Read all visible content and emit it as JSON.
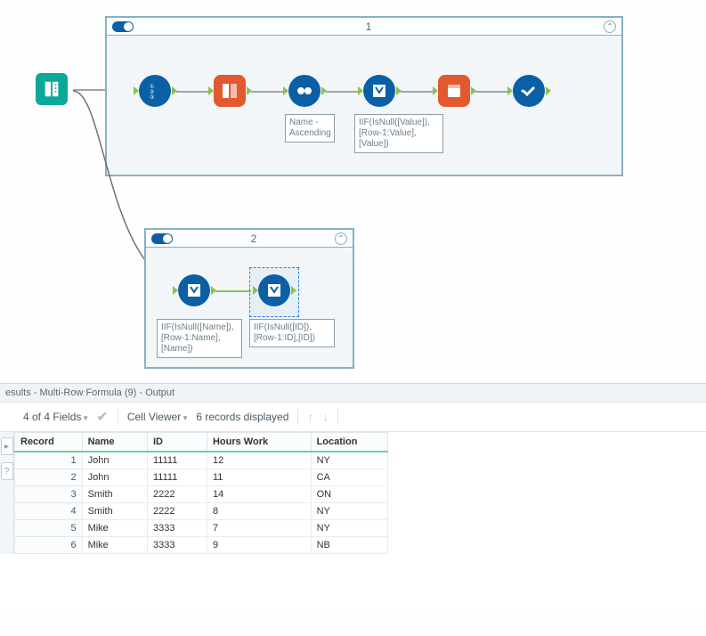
{
  "canvas": {
    "input_tool_name": "text-input",
    "container1": {
      "title": "1",
      "tools": {
        "record_id": "record-id",
        "transpose": "transpose",
        "sort": "sort",
        "multirow": "multi-row-formula",
        "crosstab": "crosstab",
        "select": "select"
      },
      "annot_sort": "Name - Ascending",
      "annot_multirow": "IIF(IsNull([Value]),[Row-1:Value],[Value])"
    },
    "container2": {
      "title": "2",
      "annot_m1": "IIF(IsNull([Name]),[Row-1:Name],[Name])",
      "annot_m2": "IIF(IsNull([ID]),[Row-1:ID],[ID])"
    }
  },
  "results": {
    "title": "esults - Multi-Row Formula (9) - Output",
    "fields_label": "4 of 4 Fields",
    "cell_viewer_label": "Cell Viewer",
    "records_label": "6 records displayed",
    "columns": [
      "Record",
      "Name",
      "ID",
      "Hours Work",
      "Location"
    ],
    "rows": [
      {
        "rec": "1",
        "name": "John",
        "id": "11111",
        "hours": "12",
        "loc": "NY"
      },
      {
        "rec": "2",
        "name": "John",
        "id": "11111",
        "hours": "11",
        "loc": "CA"
      },
      {
        "rec": "3",
        "name": "Smith",
        "id": "2222",
        "hours": "14",
        "loc": "ON"
      },
      {
        "rec": "4",
        "name": "Smith",
        "id": "2222",
        "hours": "8",
        "loc": "NY"
      },
      {
        "rec": "5",
        "name": "Mike",
        "id": "3333",
        "hours": "7",
        "loc": "NY"
      },
      {
        "rec": "6",
        "name": "Mike",
        "id": "3333",
        "hours": "9",
        "loc": "NB"
      }
    ]
  },
  "chart_data": {
    "type": "table",
    "columns": [
      "Record",
      "Name",
      "ID",
      "Hours Work",
      "Location"
    ],
    "rows": [
      [
        1,
        "John",
        11111,
        12,
        "NY"
      ],
      [
        2,
        "John",
        11111,
        11,
        "CA"
      ],
      [
        3,
        "Smith",
        2222,
        14,
        "ON"
      ],
      [
        4,
        "Smith",
        2222,
        8,
        "NY"
      ],
      [
        5,
        "Mike",
        3333,
        7,
        "NY"
      ],
      [
        6,
        "Mike",
        3333,
        9,
        "NB"
      ]
    ]
  }
}
